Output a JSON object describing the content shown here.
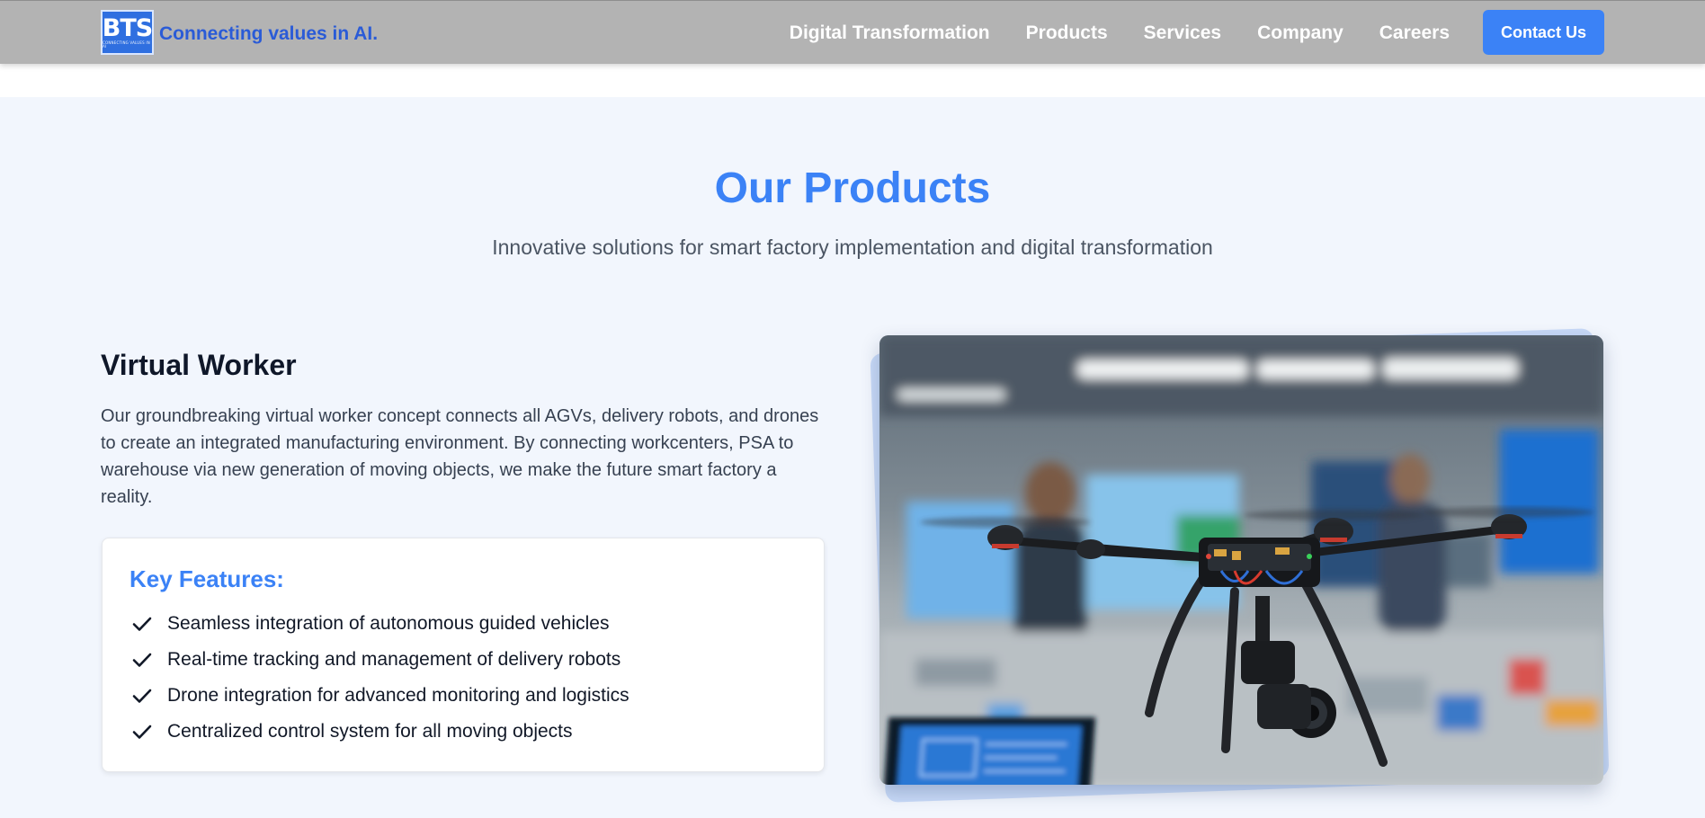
{
  "header": {
    "logo": {
      "text": "BTS",
      "subtext": "CONNECTING VALUES IN AI"
    },
    "tagline": "Connecting values in AI.",
    "nav": [
      "Digital Transformation",
      "Products",
      "Services",
      "Company",
      "Careers"
    ],
    "contact_label": "Contact Us"
  },
  "section": {
    "title": "Our Products",
    "subtitle": "Innovative solutions for smart factory implementation and digital transformation"
  },
  "product": {
    "title": "Virtual Worker",
    "description": "Our groundbreaking virtual worker concept connects all AGVs, delivery robots, and drones to create an integrated manufacturing environment. By connecting workcenters, PSA to warehouse via new generation of moving objects, we make the future smart factory a reality.",
    "features_heading": "Key Features:",
    "features": [
      "Seamless integration of autonomous guided vehicles",
      "Real-time tracking and management of delivery robots",
      "Drone integration for advanced monitoring and logistics",
      "Centralized control system for all moving objects"
    ],
    "image_icon": "drone-photo"
  },
  "colors": {
    "accent": "#3b82f6",
    "header_bg": "#b3b3b3",
    "page_bg": "#f2f6fd",
    "brand_text": "#2a5bd7"
  }
}
